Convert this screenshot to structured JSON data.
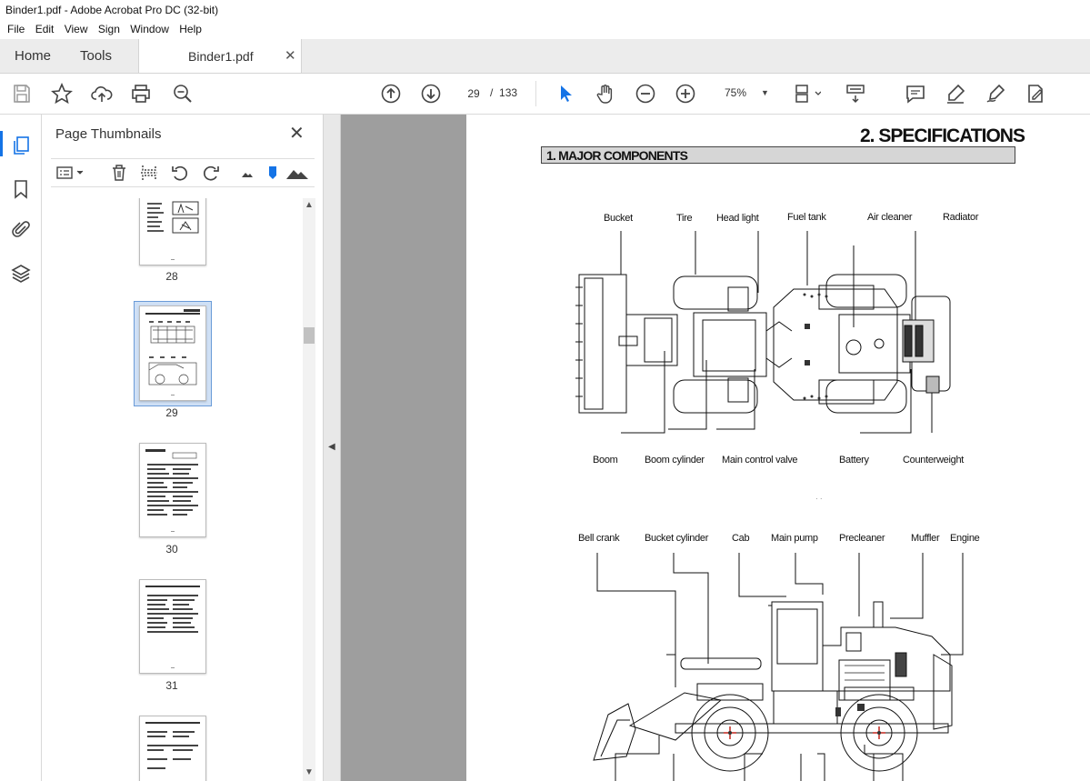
{
  "window": {
    "title": "Binder1.pdf - Adobe Acrobat Pro DC (32-bit)"
  },
  "menu": [
    "File",
    "Edit",
    "View",
    "Sign",
    "Window",
    "Help"
  ],
  "tabs": {
    "home": "Home",
    "tools": "Tools",
    "document": "Binder1.pdf"
  },
  "toolbar": {
    "current_page": "29",
    "page_separator": "/",
    "total_pages": "133",
    "zoom": "75%"
  },
  "panel": {
    "title": "Page Thumbnails",
    "thumbnails": [
      {
        "page": "28"
      },
      {
        "page": "29",
        "selected": true
      },
      {
        "page": "30"
      },
      {
        "page": "31"
      }
    ]
  },
  "document_page": {
    "heading": "2. SPECIFICATIONS",
    "section": "1. MAJOR COMPONENTS",
    "top_labels": [
      "Bucket",
      "Tire",
      "Head light",
      "Fuel tank",
      "Air cleaner",
      "Radiator"
    ],
    "bottom_labels": [
      "Boom",
      "Boom cylinder",
      "Main control valve",
      "Battery",
      "Counterweight"
    ],
    "side_labels": [
      "Bell crank",
      "Bucket cylinder",
      "Cab",
      "Main pump",
      "Precleaner",
      "Muffler",
      "Engine"
    ]
  },
  "colors": {
    "accent": "#1473e6",
    "page_bg": "#9e9e9e",
    "section_bar": "#d6d6d6"
  }
}
